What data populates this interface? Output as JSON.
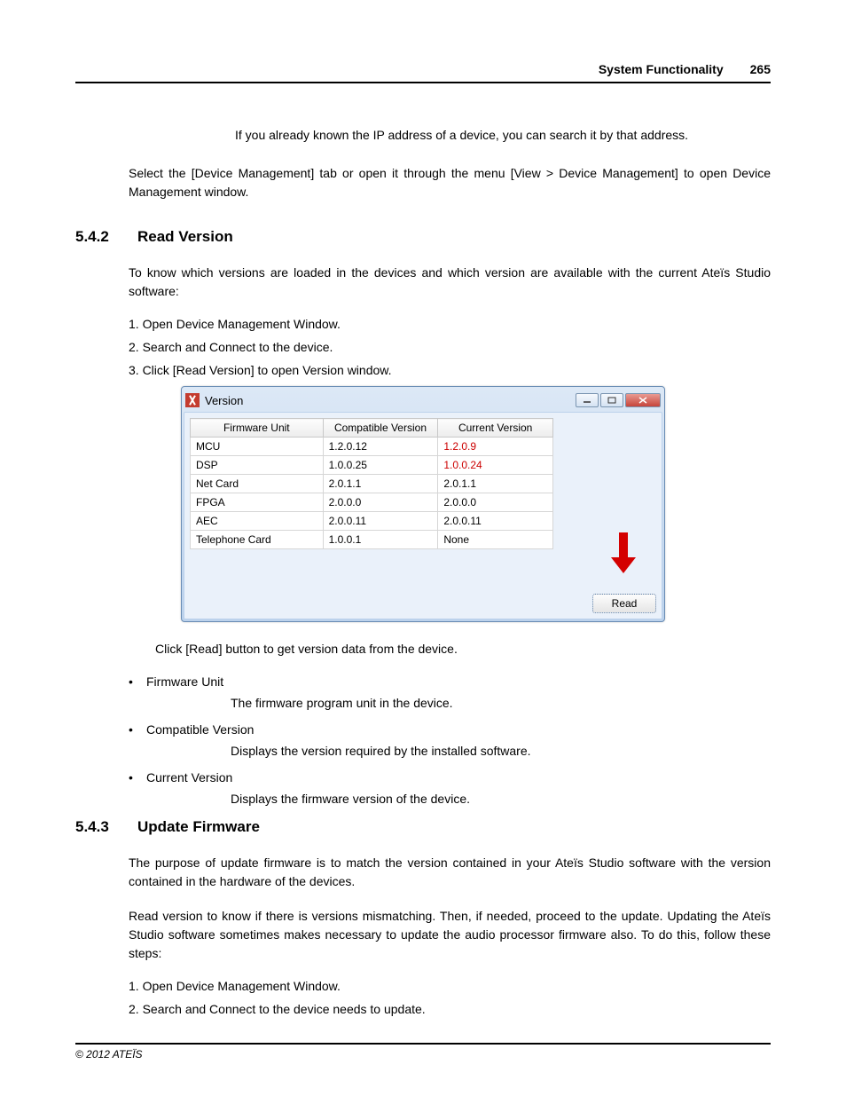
{
  "header": {
    "title": "System Functionality",
    "page": "265"
  },
  "intro": {
    "line1": "If you already known the IP address of a device, you can search it by that address.",
    "line2": "Select the [Device Management] tab or open it through the menu [View > Device Management] to open Device Management window."
  },
  "section542": {
    "num": "5.4.2",
    "title": "Read Version",
    "para": "To know which versions are loaded in the devices and which version are available with the current Ateïs Studio software:",
    "steps": [
      "1. Open Device Management Window.",
      "2. Search and Connect to the device.",
      "3. Click [Read Version] to open Version window."
    ],
    "after_window": "Click [Read] button to get version data from the device.",
    "bullets": [
      {
        "label": "Firmware Unit",
        "desc": "The firmware program unit in the device."
      },
      {
        "label": "Compatible Version",
        "desc": "Displays the version required by the installed software."
      },
      {
        "label": "Current Version",
        "desc": "Displays the firmware version of the device."
      }
    ]
  },
  "version_window": {
    "title": "Version",
    "columns": [
      "Firmware Unit",
      "Compatible Version",
      "Current Version"
    ],
    "rows": [
      {
        "unit": "MCU",
        "compat": "1.2.0.12",
        "current": "1.2.0.9",
        "mismatch": true
      },
      {
        "unit": "DSP",
        "compat": "1.0.0.25",
        "current": "1.0.0.24",
        "mismatch": true
      },
      {
        "unit": "Net Card",
        "compat": "2.0.1.1",
        "current": "2.0.1.1",
        "mismatch": false
      },
      {
        "unit": "FPGA",
        "compat": "2.0.0.0",
        "current": "2.0.0.0",
        "mismatch": false
      },
      {
        "unit": "AEC",
        "compat": "2.0.0.11",
        "current": "2.0.0.11",
        "mismatch": false
      },
      {
        "unit": "Telephone Card",
        "compat": "1.0.0.1",
        "current": "None",
        "mismatch": false
      }
    ],
    "read_button": "Read",
    "controls": {
      "min": "—",
      "max": "▢",
      "close": "X"
    }
  },
  "section543": {
    "num": "5.4.3",
    "title": "Update Firmware",
    "para1": "The purpose of update firmware is to match the version contained in your Ateïs Studio software with the version contained in the hardware of the devices.",
    "para2": "Read version to know if there is versions mismatching. Then, if needed, proceed to the update. Updating the Ateïs Studio software sometimes makes necessary to update the audio processor firmware also. To do this, follow these steps:",
    "steps": [
      "1. Open Device Management Window.",
      "2. Search and Connect to the device needs to update."
    ]
  },
  "footer": "© 2012 ATEÏS"
}
